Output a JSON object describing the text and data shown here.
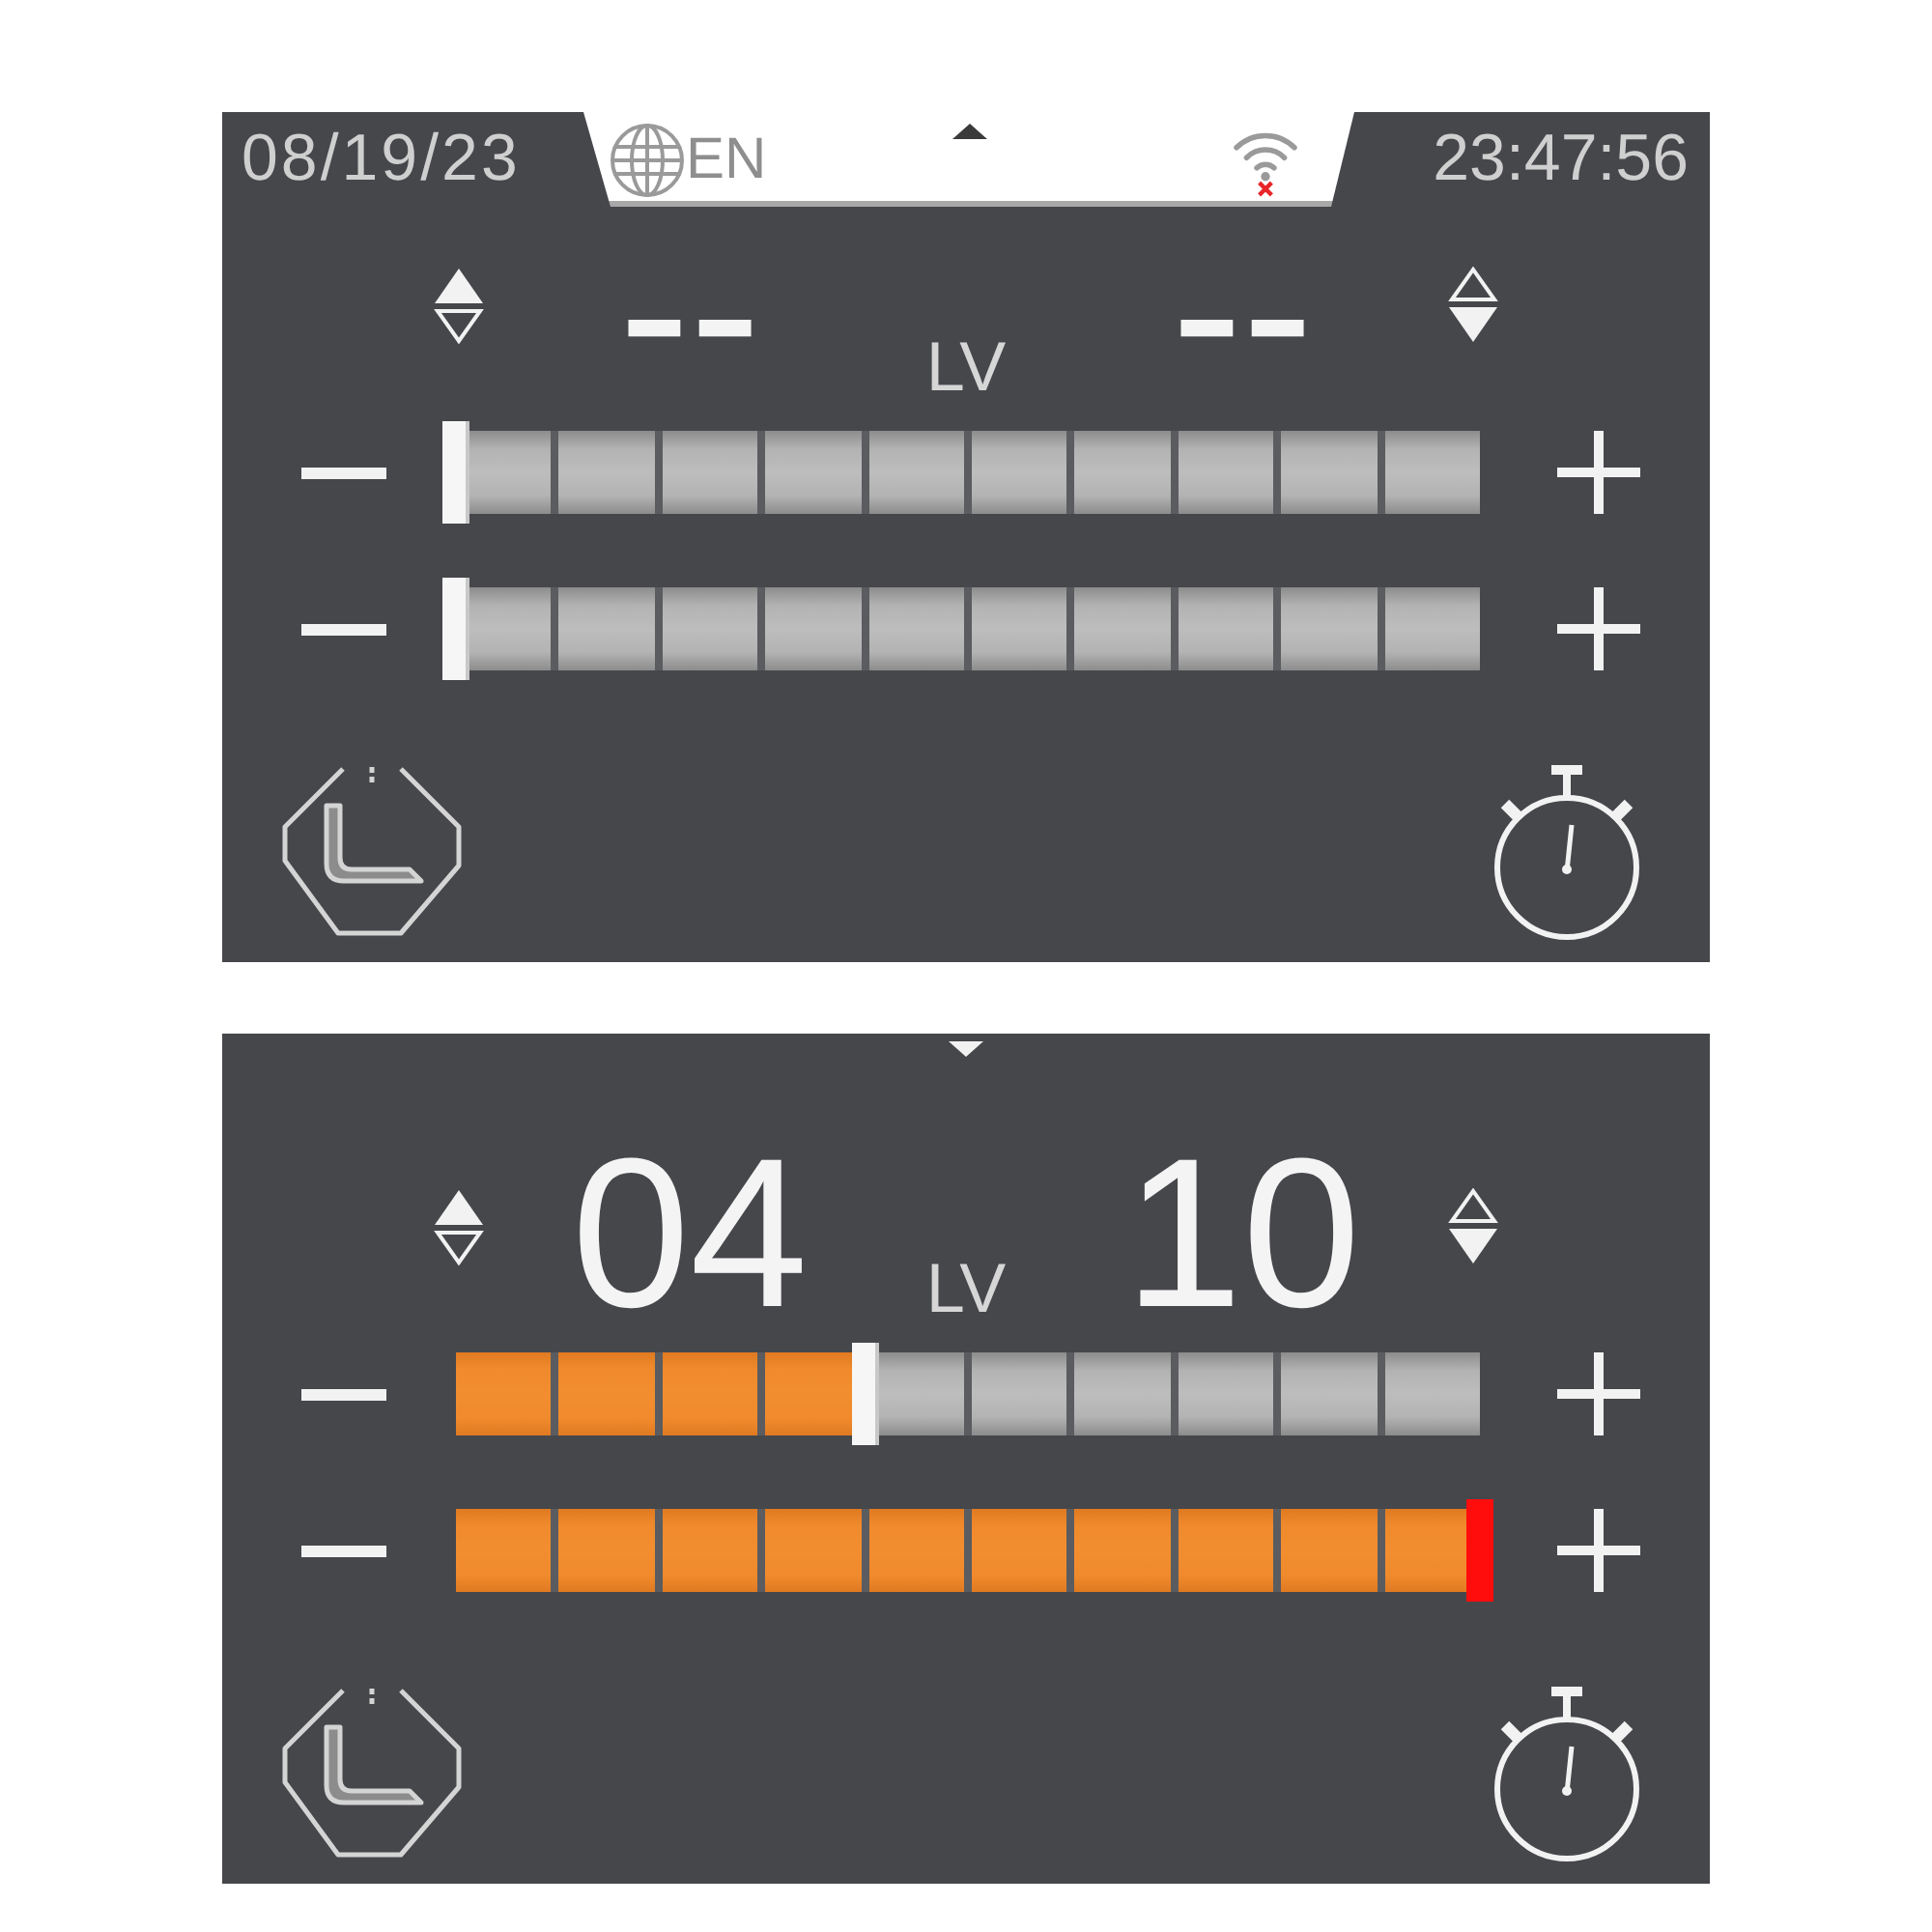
{
  "panels": [
    {
      "status_bar": {
        "date": "08/19/23",
        "language": "EN",
        "time": "23:47:56",
        "wifi": {
          "connected": false
        }
      },
      "unit_label": "LV",
      "channels": [
        {
          "reading": "--",
          "level": 0
        },
        {
          "reading": "--",
          "level": 0
        }
      ]
    },
    {
      "unit_label": "LV",
      "channels": [
        {
          "reading": "04",
          "level": 0.4
        },
        {
          "reading": "10",
          "level": 1
        }
      ]
    }
  ]
}
